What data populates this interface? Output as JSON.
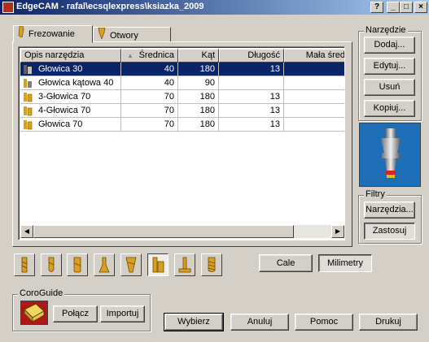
{
  "window": {
    "title": "EdgeCAM - rafal\\ecsqlexpress\\ksiazka_2009",
    "help": "?",
    "minimize": "_",
    "maximize": "□",
    "close": "×"
  },
  "tabs": [
    {
      "label": "Frezowanie",
      "active": true
    },
    {
      "label": "Otwory",
      "active": false
    }
  ],
  "table": {
    "columns": [
      "Opis narzędzia",
      "Średnica",
      "Kąt",
      "Długość",
      "Mała śred"
    ],
    "sort_indicator": "▲",
    "rows": [
      {
        "name": "Głowica 30",
        "diameter": "40",
        "angle": "180",
        "length": "13",
        "selected": true
      },
      {
        "name": "Głowica kątowa 40",
        "diameter": "40",
        "angle": "90",
        "length": "",
        "selected": false
      },
      {
        "name": "3-Głowica 70",
        "diameter": "70",
        "angle": "180",
        "length": "13",
        "selected": false
      },
      {
        "name": "4-Głowica 70",
        "diameter": "70",
        "angle": "180",
        "length": "13",
        "selected": false
      },
      {
        "name": "Głowica 70",
        "diameter": "70",
        "angle": "180",
        "length": "13",
        "selected": false
      }
    ],
    "scroll_left": "◀",
    "scroll_right": "▶"
  },
  "tools_group": {
    "label": "Narzędzie",
    "add": "Dodaj...",
    "edit": "Edytuj...",
    "delete": "Usuń",
    "copy": "Kopiuj..."
  },
  "filters_group": {
    "label": "Filtry",
    "tools": "Narzędzia...",
    "apply": "Zastosuj"
  },
  "units": {
    "inches": "Cale",
    "millimeters": "Milimetry",
    "selected": "Milimetry"
  },
  "tool_type_icons": [
    "flat-end-mill-icon",
    "ball-end-mill-icon",
    "bull-nose-mill-icon",
    "chamfer-mill-icon",
    "taper-mill-icon",
    "face-mill-icon",
    "t-slot-cutter-icon",
    "thread-mill-icon"
  ],
  "coroguide": {
    "label": "CoroGuide",
    "connect": "Połącz",
    "import": "Importuj"
  },
  "footer": {
    "select": "Wybierz",
    "cancel": "Anuluj",
    "help": "Pomoc",
    "print": "Drukuj"
  },
  "colors": {
    "titlebar_start": "#0a246a",
    "titlebar_end": "#a6caf0",
    "selection": "#0a246a",
    "tool_gold": "#d8a020",
    "preview_bg": "#1e6fb8"
  }
}
